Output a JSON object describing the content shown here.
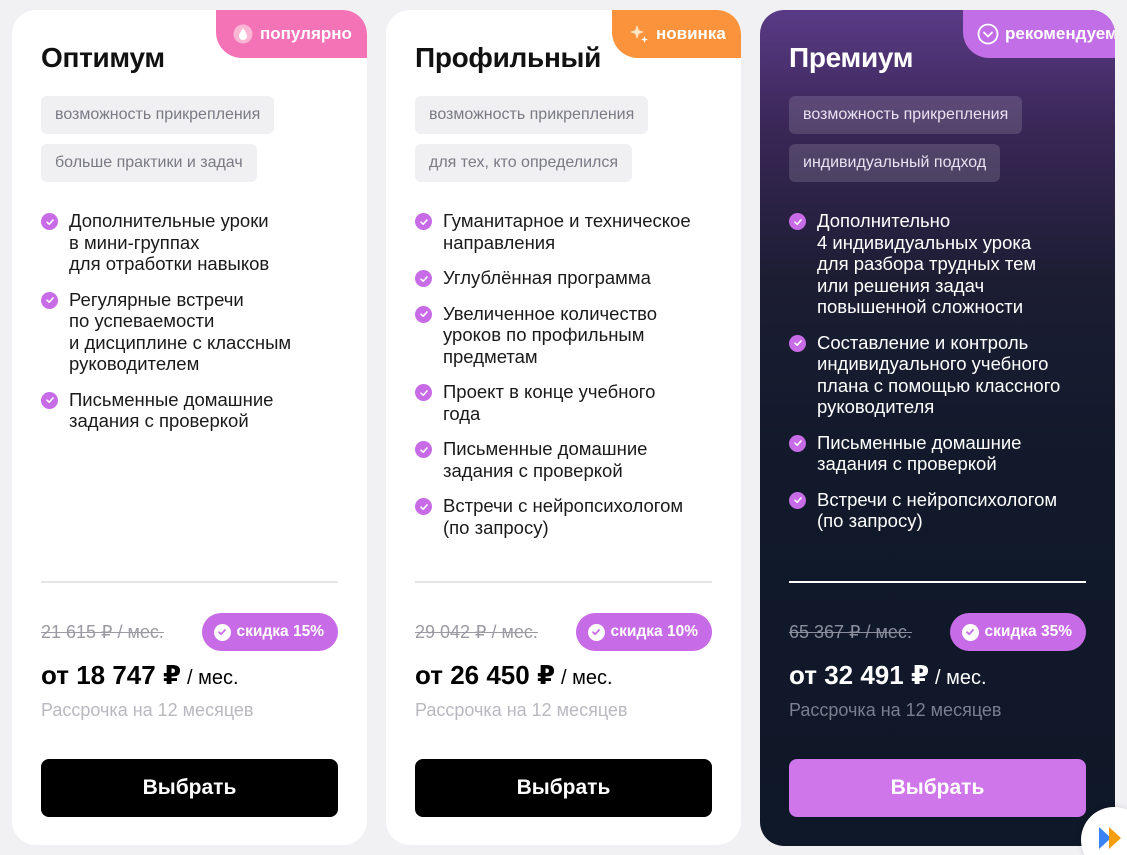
{
  "colors": {
    "accent": "#c76be6",
    "badge_popular": "#f472b6",
    "badge_new": "#fb923c",
    "badge_recommended": "#c26ee6",
    "premium_button": "#cf76ea"
  },
  "plans": [
    {
      "badge": {
        "label": "популярно",
        "icon": "drop-icon"
      },
      "title": "Оптимум",
      "tags": [
        "возможность прикрепления",
        "больше практики и задач"
      ],
      "features": [
        "Дополнительные уроки\nв мини-группах\nдля отработки навыков",
        "Регулярные встречи\nпо успеваемости\nи дисциплине с классным\nруководителем",
        "Письменные домашние\nзадания с проверкой"
      ],
      "old_price": "21 615 ₽  / мес.",
      "discount": "скидка 15%",
      "price": "от 18 747 ₽",
      "per": "/ мес.",
      "installment": "Рассрочка на 12 месяцев",
      "button": "Выбрать"
    },
    {
      "badge": {
        "label": "новинка",
        "icon": "sparkle-icon"
      },
      "title": "Профильный",
      "tags": [
        "возможность прикрепления",
        "для тех, кто определился"
      ],
      "features": [
        "Гуманитарное и техническое\nнаправления",
        "Углублённая программа",
        "Увеличенное количество\nуроков по профильным\nпредметам",
        "Проект в конце учебного\nгода",
        "Письменные домашние\nзадания с проверкой",
        "Встречи с нейропсихологом\n(по запросу)"
      ],
      "old_price": "29 042 ₽  / мес.",
      "discount": "скидка 10%",
      "price": "от 26 450 ₽",
      "per": "/ мес.",
      "installment": "Рассрочка на 12 месяцев",
      "button": "Выбрать"
    },
    {
      "badge": {
        "label": "рекомендуем",
        "icon": "chevron-circle-icon"
      },
      "title": "Премиум",
      "tags": [
        "возможность прикрепления",
        "индивидуальный подход"
      ],
      "features": [
        "Дополнительно\n4 индивидуальных урока\nдля разбора трудных тем\nили решения задач\nповышенной сложности",
        "Составление и контроль\nиндивидуального учебного\nплана с помощью классного\nруководителя",
        "Письменные домашние\nзадания с проверкой",
        "Встречи с нейропсихологом\n(по запросу)"
      ],
      "old_price": "65 367 ₽  / мес.",
      "discount": "скидка 35%",
      "price": "от 32 491 ₽",
      "per": "/ мес.",
      "installment": "Рассрочка на 12 месяцев",
      "button": "Выбрать"
    }
  ],
  "corner_widget": {
    "icon": "play-logo-icon"
  }
}
